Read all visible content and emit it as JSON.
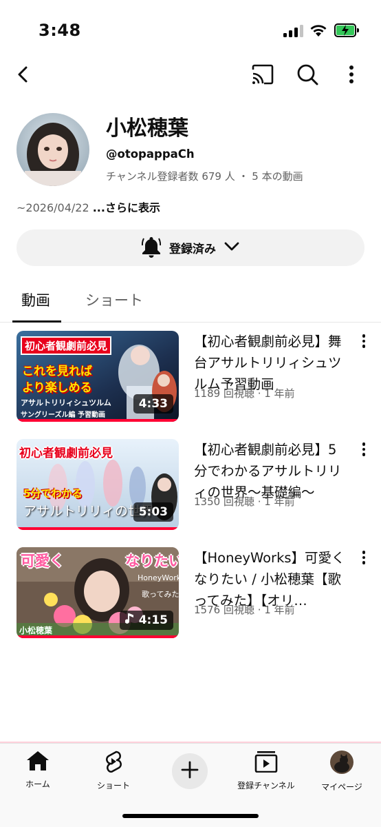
{
  "status_bar": {
    "time": "3:48"
  },
  "channel": {
    "name": "小松穂葉",
    "handle": "@otopappaCh",
    "stats": "チャンネル登録者数 679 人 ・ 5 本の動画",
    "description": "~2026/04/22 ",
    "more_label": "...さらに表示"
  },
  "subscribe": {
    "label": "登録済み"
  },
  "tabs": [
    {
      "label": "動画"
    },
    {
      "label": "ショート"
    }
  ],
  "videos": [
    {
      "title": "【初心者観劇前必見】舞台アサルトリリィシュツルム予習動画",
      "meta": "1189 回視聴 · 1 年前",
      "duration": "4:33",
      "thumb_text": [
        "初心者観劇前必見",
        "これを見れば",
        "より楽しめる",
        "アサルトリリィシュツルム",
        "サングリーズル編 予習動画"
      ]
    },
    {
      "title": "【初心者観劇前必見】5分でわかるアサルトリリィの世界〜基礎編〜",
      "meta": "1350 回視聴 · 1 年前",
      "duration": "5:03",
      "thumb_text": [
        "初心者観劇前必見",
        "5分でわかる",
        "アサルトリリィの世界"
      ]
    },
    {
      "title": "【HoneyWorks】可愛くなりたい / 小松穂葉【歌ってみた】【オリ…",
      "meta": "1576 回視聴 · 1 年前",
      "duration": "4:15",
      "thumb_text": [
        "可愛く",
        "なりたい",
        "HoneyWorks",
        "歌ってみた",
        "小松穂葉"
      ]
    }
  ],
  "bottom_nav": [
    {
      "label": "ホーム",
      "icon": "home-icon"
    },
    {
      "label": "ショート",
      "icon": "shorts-icon"
    },
    {
      "label": "",
      "icon": "create-icon"
    },
    {
      "label": "登録チャンネル",
      "icon": "subscriptions-icon"
    },
    {
      "label": "マイページ",
      "icon": "profile-avatar"
    }
  ],
  "colors": {
    "progress_red": "#ff0033",
    "battery_green": "#34c759",
    "subscribe_bg": "#f2f2f2"
  }
}
